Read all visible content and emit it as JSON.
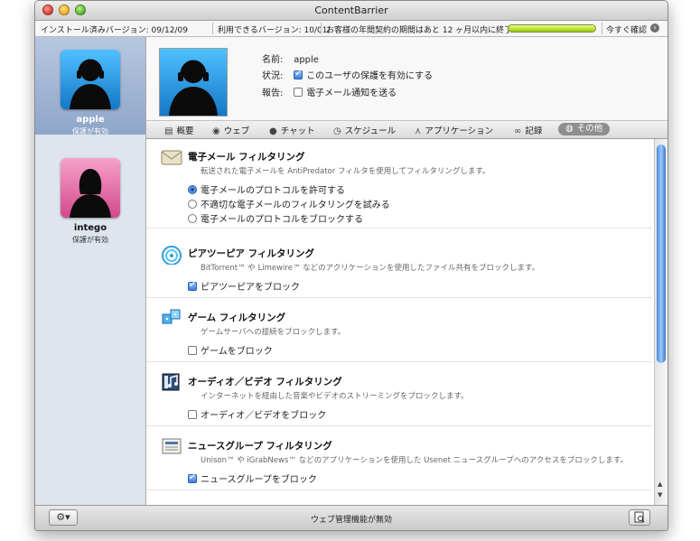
{
  "window": {
    "title": "ContentBarrier"
  },
  "infobar": {
    "installed": "インストール済みバージョン: 09/12/09",
    "available": "利用できるバージョン: 10/01/",
    "subscription": "お客様の年間契約の期間はあと 12 ヶ月以内に終了",
    "subscription_progress": 1.0,
    "check_now": "今すぐ確認"
  },
  "users": [
    {
      "name": "apple",
      "status": "保護が有効",
      "selected": true,
      "avatar_color": "#2a9ee0"
    },
    {
      "name": "intego",
      "status": "保護が有効",
      "selected": false,
      "avatar_color": "#e36ea6"
    }
  ],
  "header": {
    "name_label": "名前:",
    "name_value": "apple",
    "status_label": "状況:",
    "status_checkbox": "このユーザの保護を有効にする",
    "status_checked": true,
    "report_label": "報告:",
    "report_checkbox": "電子メール通知を送る",
    "report_checked": false
  },
  "tabs": [
    {
      "label": "概要",
      "icon": "overview-icon"
    },
    {
      "label": "ウェブ",
      "icon": "web-icon"
    },
    {
      "label": "チャット",
      "icon": "chat-icon"
    },
    {
      "label": "スケジュール",
      "icon": "clock-icon"
    },
    {
      "label": "アプリケーション",
      "icon": "application-icon"
    },
    {
      "label": "記録",
      "icon": "log-icon"
    },
    {
      "label": "その他",
      "icon": "other-icon",
      "selected": true
    }
  ],
  "sections": [
    {
      "title": "電子メール フィルタリング",
      "desc": "転送された電子メールを AntiPredator フィルタを使用してフィルタリングします。",
      "icon": "email-icon",
      "radios": [
        {
          "label": "電子メールのプロトコルを許可する",
          "selected": true
        },
        {
          "label": "不適切な電子メールのフィルタリングを試みる",
          "selected": false
        },
        {
          "label": "電子メールのプロトコルをブロックする",
          "selected": false
        }
      ]
    },
    {
      "title": "ピアツーピア フィルタリング",
      "desc": "BitTorrent™ や Limewire™ などのアクリケーションを使用したファイル共有をブロックします。",
      "icon": "peer-to-peer-icon",
      "checkbox": {
        "label": "ピアツーピアをブロック",
        "checked": true
      }
    },
    {
      "title": "ゲーム フィルタリング",
      "desc": "ゲームサーバへの接続をブロックします。",
      "icon": "game-icon",
      "checkbox": {
        "label": "ゲームをブロック",
        "checked": false
      }
    },
    {
      "title": "オーディオ／ビデオ フィルタリング",
      "desc": "インターネットを経由した音楽やビデオのストリーミングをブロックします。",
      "icon": "audio-video-icon",
      "checkbox": {
        "label": "オーディオ／ビデオをブロック",
        "checked": false
      }
    },
    {
      "title": "ニュースグループ フィルタリング",
      "desc": "Unison™ や iGrabNews™ などのアプリケーションを使用した Usenet ニュースグループへのアクセスをブロックします。",
      "icon": "newsgroup-icon",
      "checkbox": {
        "label": "ニュースグループをブロック",
        "checked": true
      }
    }
  ],
  "bottom": {
    "status": "ウェブ管理機能が無効"
  }
}
